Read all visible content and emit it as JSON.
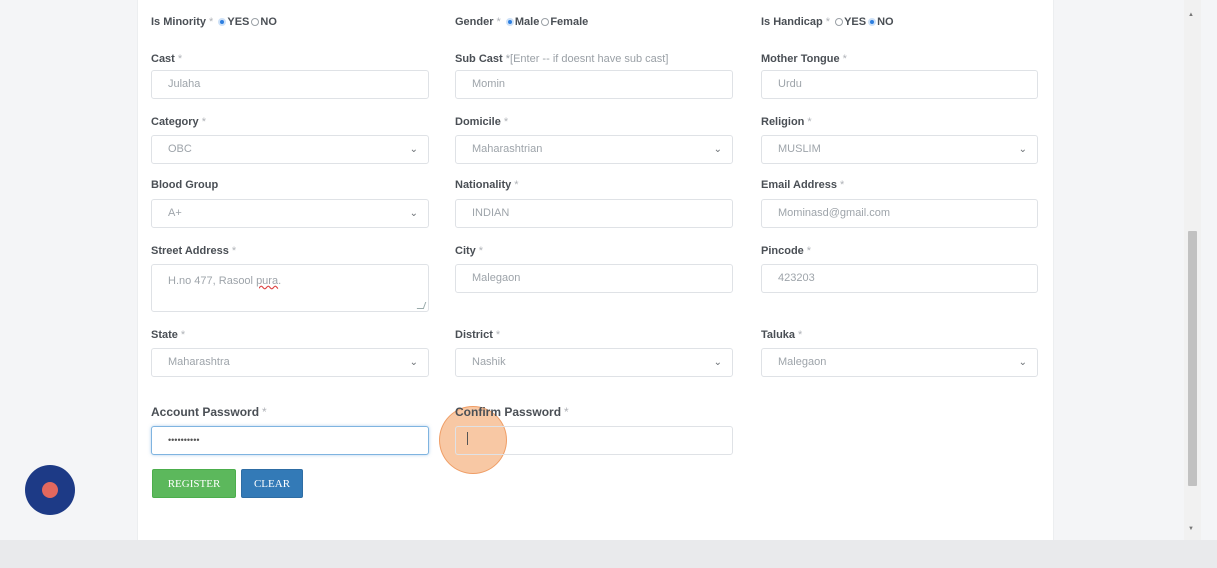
{
  "row_radios": {
    "minority": {
      "label": "Is Minority",
      "options": [
        "YES",
        "NO"
      ],
      "selected": "YES"
    },
    "gender": {
      "label": "Gender",
      "options": [
        "Male",
        "Female"
      ],
      "selected": "Male"
    },
    "handicap": {
      "label": "Is Handicap",
      "options": [
        "YES",
        "NO"
      ],
      "selected": "NO"
    }
  },
  "required_mark": "*",
  "fields": {
    "cast": {
      "label": "Cast",
      "value": "Julaha"
    },
    "sub_cast": {
      "label": "Sub Cast",
      "hint": "*[Enter -- if doesnt have sub cast]",
      "value": "Momin"
    },
    "mother_tongue": {
      "label": "Mother Tongue",
      "value": "Urdu"
    },
    "category": {
      "label": "Category",
      "value": "OBC"
    },
    "domicile": {
      "label": "Domicile",
      "value": "Maharashtrian"
    },
    "religion": {
      "label": "Religion",
      "value": "MUSLIM"
    },
    "blood_group": {
      "label": "Blood Group",
      "value": "A+"
    },
    "nationality": {
      "label": "Nationality",
      "value": "INDIAN"
    },
    "email": {
      "label": "Email Address",
      "value": "Mominasd@gmail.com"
    },
    "street": {
      "label": "Street Address",
      "value_prefix": "H.no 477, Rasool ",
      "value_marked": "pura",
      "value_suffix": "."
    },
    "city": {
      "label": "City",
      "value": "Malegaon"
    },
    "pincode": {
      "label": "Pincode",
      "value": "423203"
    },
    "state": {
      "label": "State",
      "value": "Maharashtra"
    },
    "district": {
      "label": "District",
      "value": "Nashik"
    },
    "taluka": {
      "label": "Taluka",
      "value": "Malegaon"
    },
    "password": {
      "label": "Account Password",
      "value": "••••••••••"
    },
    "confirm_password": {
      "label": "Confirm Password",
      "value": ""
    }
  },
  "buttons": {
    "register": "REGISTER",
    "clear": "CLEAR"
  },
  "icons": {
    "select": "chevron-down-icon",
    "scroll_up": "triangle-up-icon",
    "scroll_down": "triangle-down-icon"
  },
  "colors": {
    "register": "#5cb85c",
    "clear": "#337ab7",
    "fab": "#1d3a86",
    "fab_dot": "#e2685e",
    "click_highlight": "#f39b5a"
  }
}
